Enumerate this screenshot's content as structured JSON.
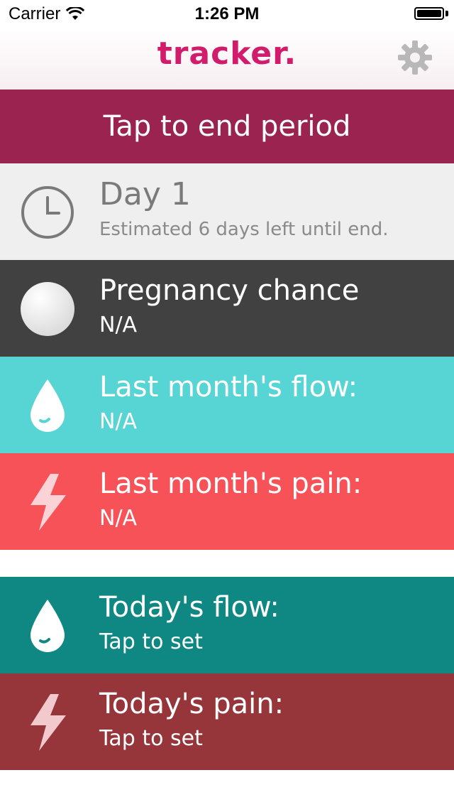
{
  "status_bar": {
    "carrier": "Carrier",
    "time": "1:26 PM"
  },
  "header": {
    "logo": "tracker."
  },
  "cta": {
    "label": "Tap to end period"
  },
  "rows": {
    "day": {
      "title": "Day 1",
      "subtitle": "Estimated 6 days left until end."
    },
    "pregnancy": {
      "title": "Pregnancy chance",
      "subtitle": "N/A"
    },
    "last_flow": {
      "title": "Last month's flow:",
      "subtitle": "N/A"
    },
    "last_pain": {
      "title": "Last month's pain:",
      "subtitle": "N/A"
    },
    "today_flow": {
      "title": "Today's flow:",
      "subtitle": "Tap to set"
    },
    "today_pain": {
      "title": "Today's pain:",
      "subtitle": "Tap to set"
    }
  },
  "icons": {
    "wifi": "wifi-icon",
    "battery": "battery-icon",
    "settings": "gear-icon",
    "clock": "clock-icon",
    "pregnancy": "circle-icon",
    "flow": "drop-icon",
    "pain": "lightning-icon"
  },
  "colors": {
    "brand": "#d11b6b",
    "cta": "#9b2350",
    "day_row": "#efefef",
    "pregnancy_row": "#414141",
    "last_flow_row": "#57d4d4",
    "last_pain_row": "#f75258",
    "today_flow_row": "#0f8782",
    "today_pain_row": "#97363a"
  }
}
